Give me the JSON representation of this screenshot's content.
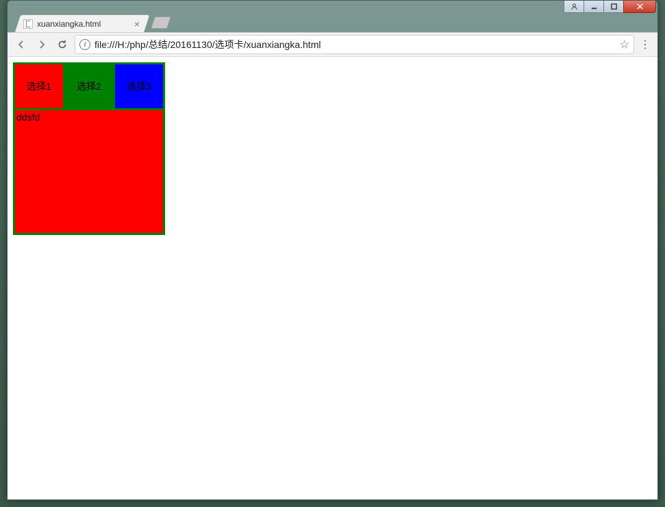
{
  "window": {
    "tab_title": "xuanxiangka.html",
    "tab_close": "×"
  },
  "toolbar": {
    "url": "file:///H:/php/总结/20161130/选项卡/xuanxiangka.html",
    "info_label": "i",
    "star_label": "☆",
    "menu_label": "⋮"
  },
  "demo": {
    "tabs": [
      {
        "label": "选择1"
      },
      {
        "label": "选择2"
      },
      {
        "label": "选择3"
      }
    ],
    "panel_text": "ddsfd"
  }
}
